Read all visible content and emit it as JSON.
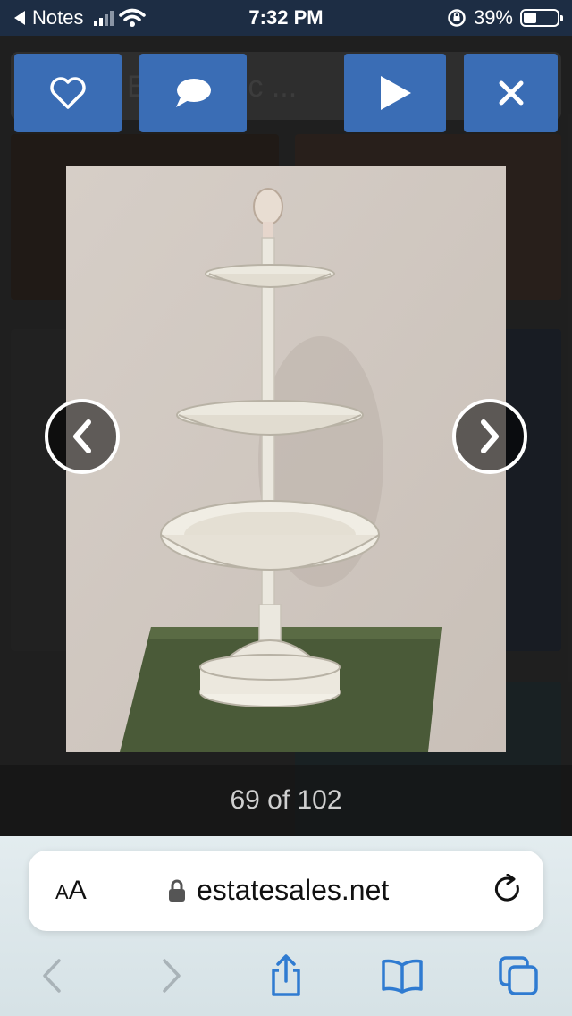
{
  "status": {
    "back_app": "Notes",
    "time": "7:32 PM",
    "battery_percent": "39%",
    "battery_level": 0.39
  },
  "background": {
    "search_placeholder": "E  ity, zip c  ..."
  },
  "toolbar": {
    "favorite_icon": "heart-icon",
    "comment_icon": "speech-bubble-icon",
    "slideshow_icon": "play-icon",
    "close_icon": "close-icon",
    "accent": "#3a6db5"
  },
  "gallery": {
    "counter": "69 of 102",
    "current": 69,
    "total": 102
  },
  "browser": {
    "text_size_label_small": "A",
    "text_size_label_large": "A",
    "url": "estatesales.net"
  }
}
